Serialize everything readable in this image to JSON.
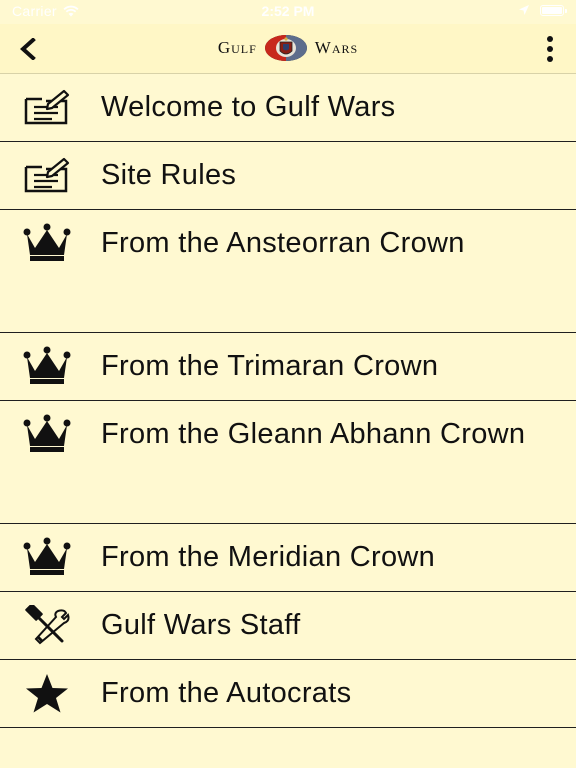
{
  "status_bar": {
    "carrier": "Carrier",
    "time": "2:52 PM",
    "battery_level": 1.0
  },
  "nav": {
    "back_icon": "chevron-left-icon",
    "title_left": "Gulf",
    "title_right": "Wars",
    "logo_icon": "gulf-wars-crest-icon",
    "more_icon": "more-vertical-icon"
  },
  "menu": {
    "items": [
      {
        "label": "Welcome to Gulf Wars",
        "icon": "notepad-icon"
      },
      {
        "label": "Site Rules",
        "icon": "notepad-icon"
      },
      {
        "label": "From the Ansteorran Crown",
        "icon": "crown-icon"
      },
      {
        "label": "From the Trimaran Crown",
        "icon": "crown-icon"
      },
      {
        "label": "From the Gleann Abhann Crown",
        "icon": "crown-icon"
      },
      {
        "label": "From the Meridian Crown",
        "icon": "crown-icon"
      },
      {
        "label": "Gulf Wars Staff",
        "icon": "hammer-wrench-icon"
      },
      {
        "label": "From the Autocrats",
        "icon": "star-icon"
      }
    ]
  },
  "colors": {
    "background": "#fff9d1",
    "nav_background": "#fff7c6",
    "text": "#111111",
    "divider": "#1f1f1f"
  }
}
